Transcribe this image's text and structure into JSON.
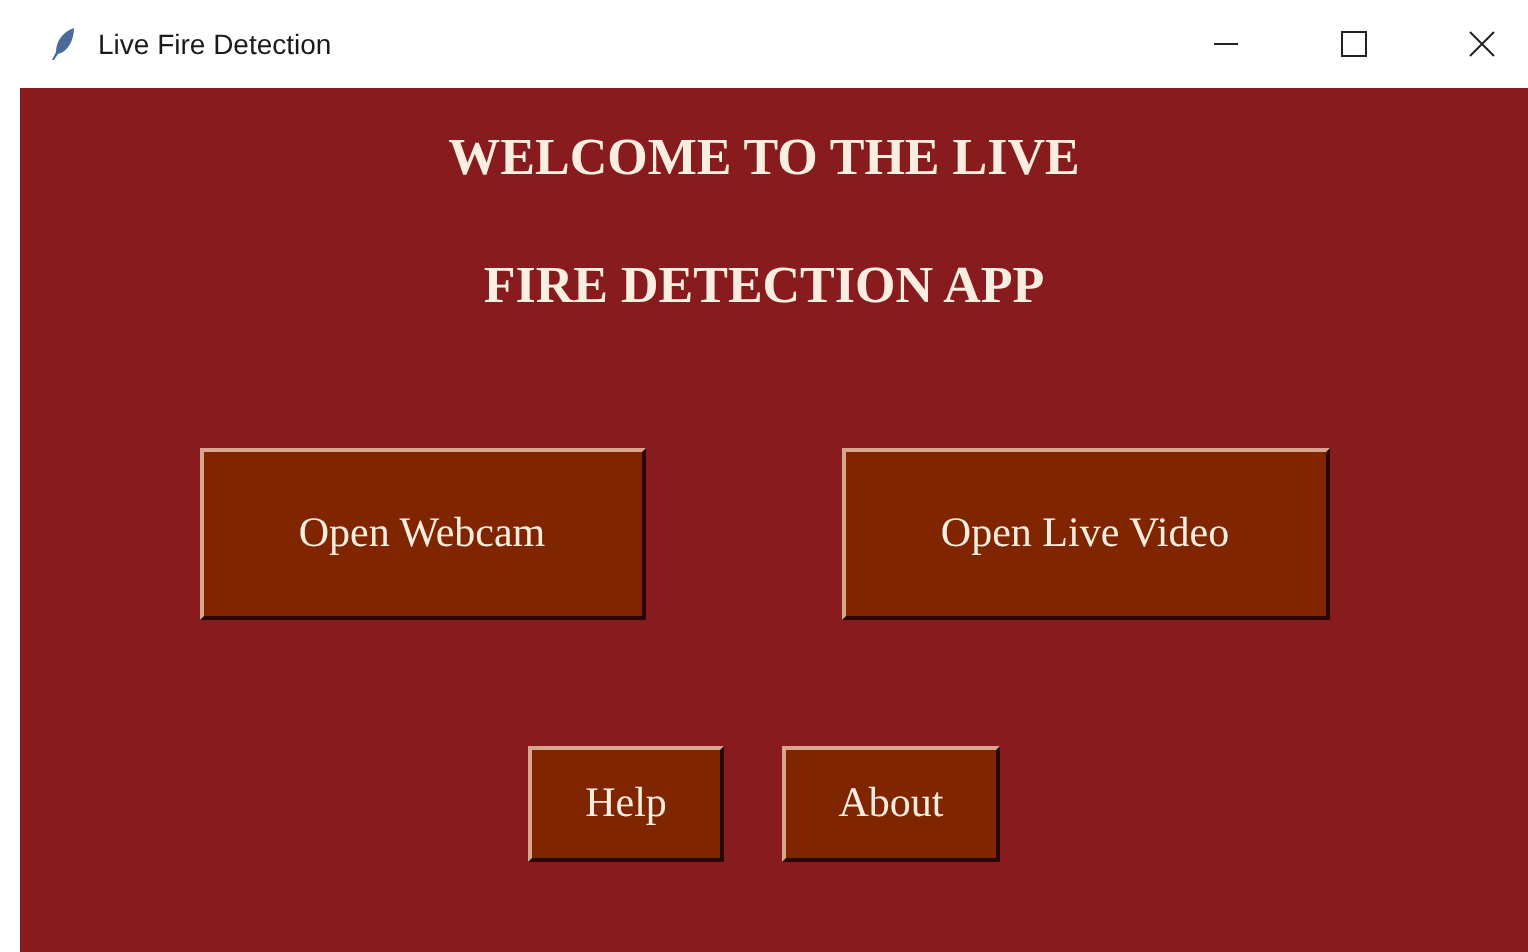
{
  "window": {
    "title": "Live Fire Detection"
  },
  "heading": [
    "WELCOME TO THE LIVE",
    "FIRE DETECTION APP"
  ],
  "main_buttons": [
    "Open Webcam",
    "Open Live Video"
  ],
  "small_buttons": [
    "Help",
    "About"
  ]
}
